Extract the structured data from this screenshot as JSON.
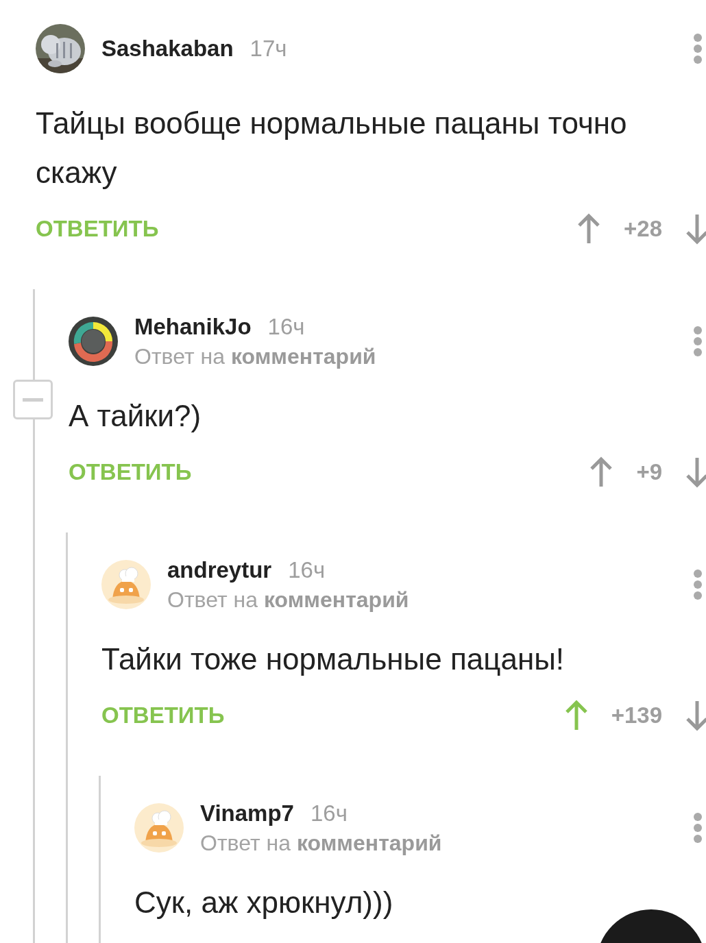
{
  "comments": [
    {
      "author": "Sashakaban",
      "time": "17ч",
      "text": "Тайцы вообще нормальные пацаны точно скажу",
      "reply_label": "ОТВЕТИТЬ",
      "score": "+28",
      "upvoted": false,
      "children": [
        {
          "author": "MehanikJo",
          "time": "16ч",
          "reply_to": {
            "prefix": "Ответ на",
            "link": "комментарий"
          },
          "expanded": true,
          "text": "А тайки?)",
          "reply_label": "ОТВЕТИТЬ",
          "score": "+9",
          "upvoted": false,
          "children": [
            {
              "author": "andreytur",
              "time": "16ч",
              "avatar": {
                "kind": "default"
              },
              "reply_to": {
                "prefix": "Ответ на",
                "link": "комментарий"
              },
              "text": "Тайки тоже нормальные пацаны!",
              "reply_label": "ОТВЕТИТЬ",
              "score": "+139",
              "upvoted": true,
              "children": [
                {
                  "author": "Vinamp7",
                  "time": "16ч",
                  "avatar": {
                    "kind": "default"
                  },
                  "reply_to": {
                    "prefix": "Ответ на",
                    "link": "комментарий"
                  },
                  "text": "Сук, аж хрюкнул)))"
                }
              ]
            }
          ]
        }
      ]
    }
  ]
}
